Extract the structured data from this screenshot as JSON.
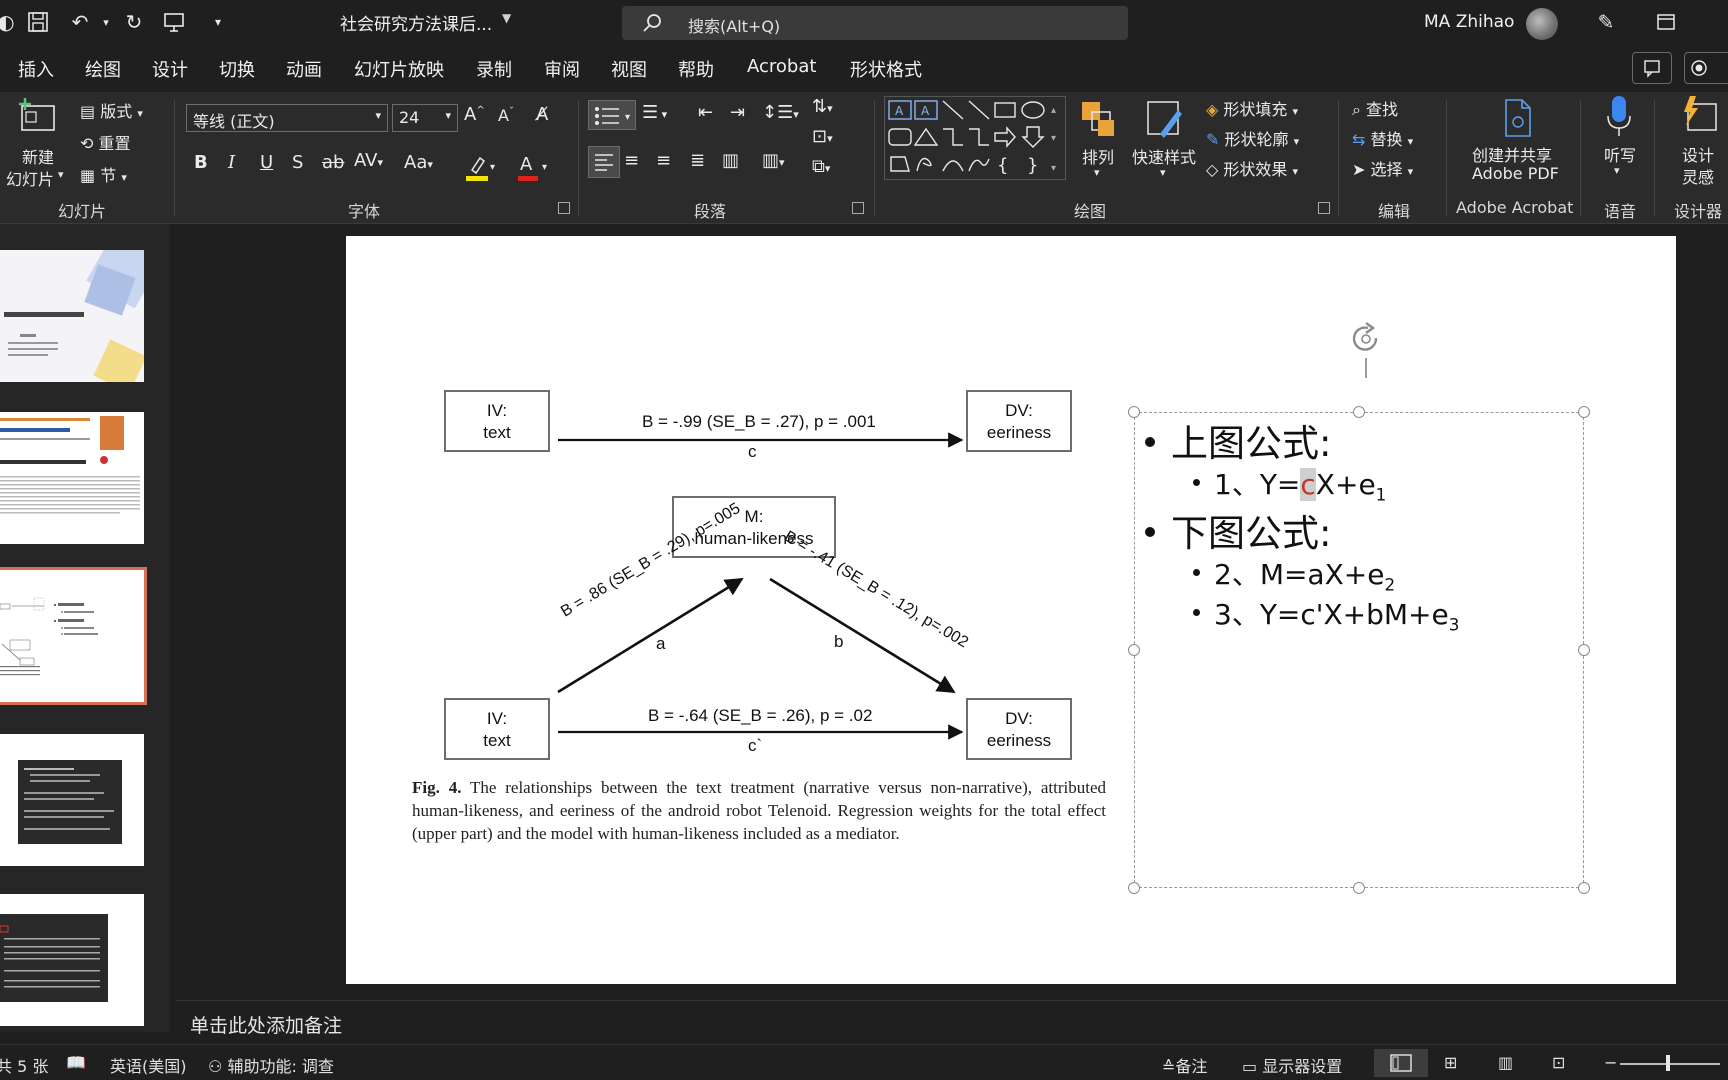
{
  "titlebar": {
    "doc_title": "社会研究方法课后...",
    "search_text": "搜索(Alt+Q)",
    "user_name": "MA Zhihao"
  },
  "menu": {
    "tabs": [
      "插入",
      "绘图",
      "设计",
      "切换",
      "动画",
      "幻灯片放映",
      "录制",
      "审阅",
      "视图",
      "帮助",
      "Acrobat",
      "形状格式"
    ]
  },
  "ribbon": {
    "slides": {
      "new_slide": "新建",
      "new_slide2": "幻灯片",
      "layout": "版式",
      "reset": "重置",
      "section": "节",
      "label": "幻灯片"
    },
    "font": {
      "font_name": "等线 (正文)",
      "font_size": "24",
      "label": "字体"
    },
    "paragraph": {
      "label": "段落"
    },
    "drawing": {
      "arrange": "排列",
      "quick_styles": "快速样式",
      "shape_fill": "形状填充",
      "shape_outline": "形状轮廓",
      "shape_effects": "形状效果",
      "label": "绘图"
    },
    "editing": {
      "find": "查找",
      "replace": "替换",
      "select": "选择",
      "label": "编辑"
    },
    "acrobat": {
      "create_share": "创建并共享",
      "adobe_pdf": "Adobe PDF",
      "label": "Adobe Acrobat"
    },
    "voice": {
      "dictate": "听写",
      "label": "语音"
    },
    "designer": {
      "design": "设计",
      "ideas": "灵感",
      "label": "设计器"
    }
  },
  "slide": {
    "boxes": {
      "iv_top": [
        "IV:",
        "text"
      ],
      "dv_top": [
        "DV:",
        "eeriness"
      ],
      "mediator": [
        "M:",
        "human-likeness"
      ],
      "iv_bottom": [
        "IV:",
        "text"
      ],
      "dv_bottom": [
        "DV:",
        "eeriness"
      ]
    },
    "paths": {
      "c_label": "B = -.99 (SE_B = .27), p = .001",
      "c_letter": "c",
      "a_label": "B = .86 (SE_B = .29), p=.005",
      "a_letter": "a",
      "b_label": "B = -.41 (SE_B = .12), p=.002",
      "b_letter": "b",
      "cprime_label": "B = -.64 (SE_B = .26), p = .02",
      "cprime_letter": "c`"
    },
    "caption_bold": "Fig. 4.",
    "caption": "The relationships between the text treatment (narrative versus non-narrative), attributed human-likeness, and eeriness of the android robot Telenoid. Regression weights for the total effect (upper part) and the model with human-likeness included as a mediator.",
    "textbox": {
      "heading1": "上图公式:",
      "eq1": "1、Y=cX+e1",
      "heading2": "下图公式:",
      "eq2": "2、M=aX+e2",
      "eq3": "3、Y=c'X+bM+e3"
    }
  },
  "notes_placeholder": "单击此处添加备注",
  "statusbar": {
    "slide_count": "共 5 张",
    "language": "英语(美国)",
    "accessibility": "辅助功能: 调查",
    "notes": "备注",
    "display_settings": "显示器设置"
  }
}
